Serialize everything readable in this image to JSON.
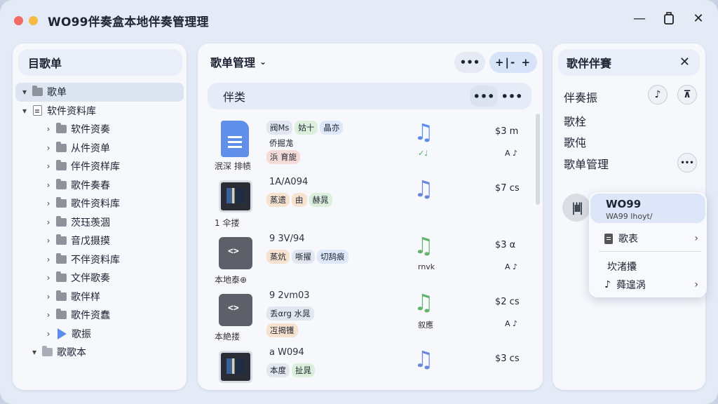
{
  "app": {
    "title": "WO99伴奏盒本地伴奏管理理",
    "icons": {
      "minimize": "minimize-icon",
      "maximize": "maximize-icon",
      "close": "close-icon"
    }
  },
  "left": {
    "header": "目歌单",
    "tree": [
      {
        "label": "歌单",
        "level": 0,
        "expand": "▾",
        "icon": "folder",
        "selected": true
      },
      {
        "label": "软件资料库",
        "level": 0,
        "expand": "▾",
        "icon": "doc"
      },
      {
        "label": "软件资奏",
        "level": 1,
        "expand": "›",
        "icon": "folder"
      },
      {
        "label": "从件资单",
        "level": 1,
        "expand": "›",
        "icon": "folder"
      },
      {
        "label": "伴件资样库",
        "level": 1,
        "expand": "›",
        "icon": "folder"
      },
      {
        "label": "歌件奏春",
        "level": 1,
        "expand": "›",
        "icon": "folder"
      },
      {
        "label": "歌件资料库",
        "level": 1,
        "expand": "›",
        "icon": "folder"
      },
      {
        "label": "茨珏羡涸",
        "level": 1,
        "expand": "›",
        "icon": "folder"
      },
      {
        "label": "音戊摄摸",
        "level": 1,
        "expand": "›",
        "icon": "folder"
      },
      {
        "label": "不伴资料库",
        "level": 1,
        "expand": "›",
        "icon": "folder"
      },
      {
        "label": "文伴歌奏",
        "level": 1,
        "expand": "›",
        "icon": "folder"
      },
      {
        "label": "歌伴样",
        "level": 1,
        "expand": "›",
        "icon": "folder"
      },
      {
        "label": "歌件资蠢",
        "level": 1,
        "expand": "›",
        "icon": "folder"
      },
      {
        "label": "歌振",
        "level": 1,
        "expand": "›",
        "icon": "play"
      },
      {
        "label": "歌歌本",
        "level": 0,
        "expand": "▾",
        "icon": "folder-light"
      }
    ]
  },
  "middle": {
    "title": "歌单管理",
    "more": "•••",
    "add": "+|- +",
    "sub_header": "伴类",
    "sub_more": "•••",
    "songs": [
      {
        "thumb": "doc",
        "thumb_label": "泯深 排帻",
        "title": "",
        "tags": [
          {
            "t": "阀Ms",
            "c": "gray"
          },
          {
            "t": "姑十",
            "c": "green"
          },
          {
            "t": "晶亦",
            "c": "blue"
          }
        ],
        "tags2": [
          {
            "t": "侨掘尨",
            "c": "plain"
          }
        ],
        "tags3": [
          {
            "t": "浜 育旎",
            "c": "red"
          }
        ],
        "note_color": "#5b8ef0",
        "note_sub": "✓♩",
        "duration": "$3 m",
        "dur_sub": "A ♪"
      },
      {
        "thumb": "photo",
        "thumb_label": "1 伞搂",
        "title": "1A/A094",
        "tags": [
          {
            "t": "蒸遗",
            "c": "orange"
          },
          {
            "t": "由",
            "c": "orange"
          },
          {
            "t": "赫晁",
            "c": "green"
          }
        ],
        "tags2": [],
        "tags3": [],
        "note_color": "#6c86dc",
        "note_sub": "",
        "duration": "$7 cs",
        "dur_sub": ""
      },
      {
        "thumb": "code",
        "thumb_label": "本地泰⊕",
        "title": "9 3V/94",
        "tags": [
          {
            "t": "蒸炕",
            "c": "orange"
          },
          {
            "t": "哳擢",
            "c": "gray"
          },
          {
            "t": "切鸹痕",
            "c": "blue"
          }
        ],
        "tags2": [],
        "tags3": [],
        "note_color": "#63b46b",
        "note_sub": "rnvk",
        "duration": "$3 α",
        "dur_sub": "A ♪"
      },
      {
        "thumb": "code",
        "thumb_label": "本絶搂",
        "title": "9 2vm03",
        "tags": [
          {
            "t": "丢αrg 水晁",
            "c": "gray"
          }
        ],
        "tags2": [],
        "tags3": [
          {
            "t": "冱揭镬",
            "c": "orange"
          }
        ],
        "note_color": "#63b46b",
        "note_sub": "叙應",
        "duration": "$2 cs",
        "dur_sub": "A ♪"
      },
      {
        "thumb": "photo",
        "thumb_label": "",
        "title": "a W094",
        "tags": [
          {
            "t": "本度",
            "c": "gray"
          },
          {
            "t": "扯晁",
            "c": "green"
          }
        ],
        "tags2": [],
        "tags3": [],
        "note_color": "#6c86dc",
        "note_sub": "",
        "duration": "$3 cs",
        "dur_sub": ""
      }
    ]
  },
  "right": {
    "header": "歌伴伴賽",
    "rows": [
      {
        "label": "伴奏振"
      },
      {
        "label": "歌栓"
      },
      {
        "label": "歌伅"
      },
      {
        "label": "歌单管理"
      }
    ],
    "note_btn": "♪",
    "filter_btn": "⊼",
    "more_btn": "•••",
    "wave": "|ılıl|"
  },
  "popup": {
    "title": "WO99",
    "subtitle": "WA99 lhoyt/",
    "items": [
      {
        "label": "歌表",
        "icon": "doc",
        "arrow": "›"
      },
      {
        "label": "坎渚攮",
        "icon": "",
        "arrow": ""
      },
      {
        "label": "蕣遑涡",
        "icon": "note",
        "arrow": "›"
      }
    ]
  }
}
